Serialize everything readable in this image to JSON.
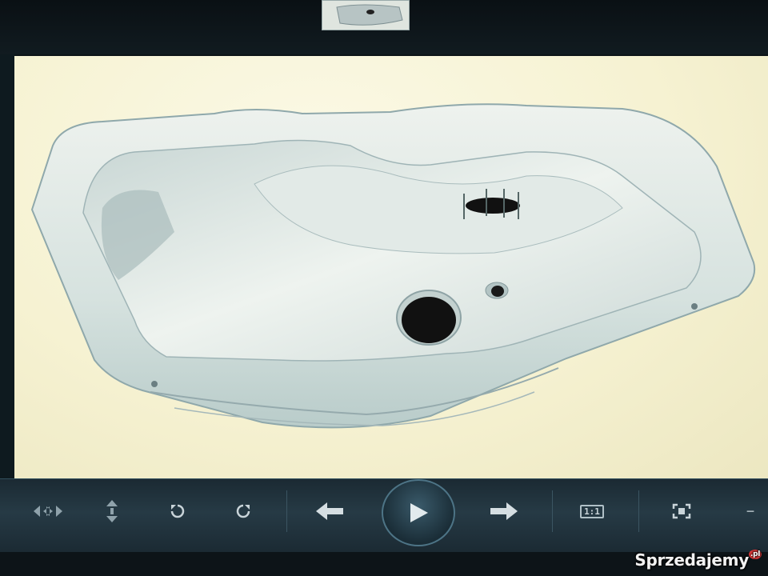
{
  "thumbnail": {
    "icon": "fuel-tank-thumbnail"
  },
  "viewer": {
    "image_subject": "fuel-tank-photo"
  },
  "toolbar": {
    "buttons": [
      {
        "name": "fit-width-button",
        "icon": "horizontal-arrows-icon"
      },
      {
        "name": "fit-height-button",
        "icon": "vertical-arrows-icon"
      },
      {
        "name": "rotate-left-button",
        "icon": "rotate-ccw-icon"
      },
      {
        "name": "rotate-right-button",
        "icon": "rotate-cw-icon"
      },
      {
        "name": "previous-button",
        "icon": "arrow-left-icon"
      },
      {
        "name": "play-button",
        "icon": "play-icon"
      },
      {
        "name": "next-button",
        "icon": "arrow-right-icon"
      },
      {
        "name": "actual-size-button",
        "label": "1:1"
      },
      {
        "name": "fullscreen-button",
        "icon": "fullscreen-icon"
      },
      {
        "name": "zoom-out-button",
        "label": "−"
      }
    ],
    "actual_size_label": "1:1",
    "zoom_out_label": "−"
  },
  "watermark": {
    "text": "Sprzedajemy",
    "suffix": ".pl"
  },
  "colors": {
    "toolbar_bg": "#263a45",
    "icon": "#c9d4d9",
    "viewer_bg": "#f6f2d2"
  }
}
